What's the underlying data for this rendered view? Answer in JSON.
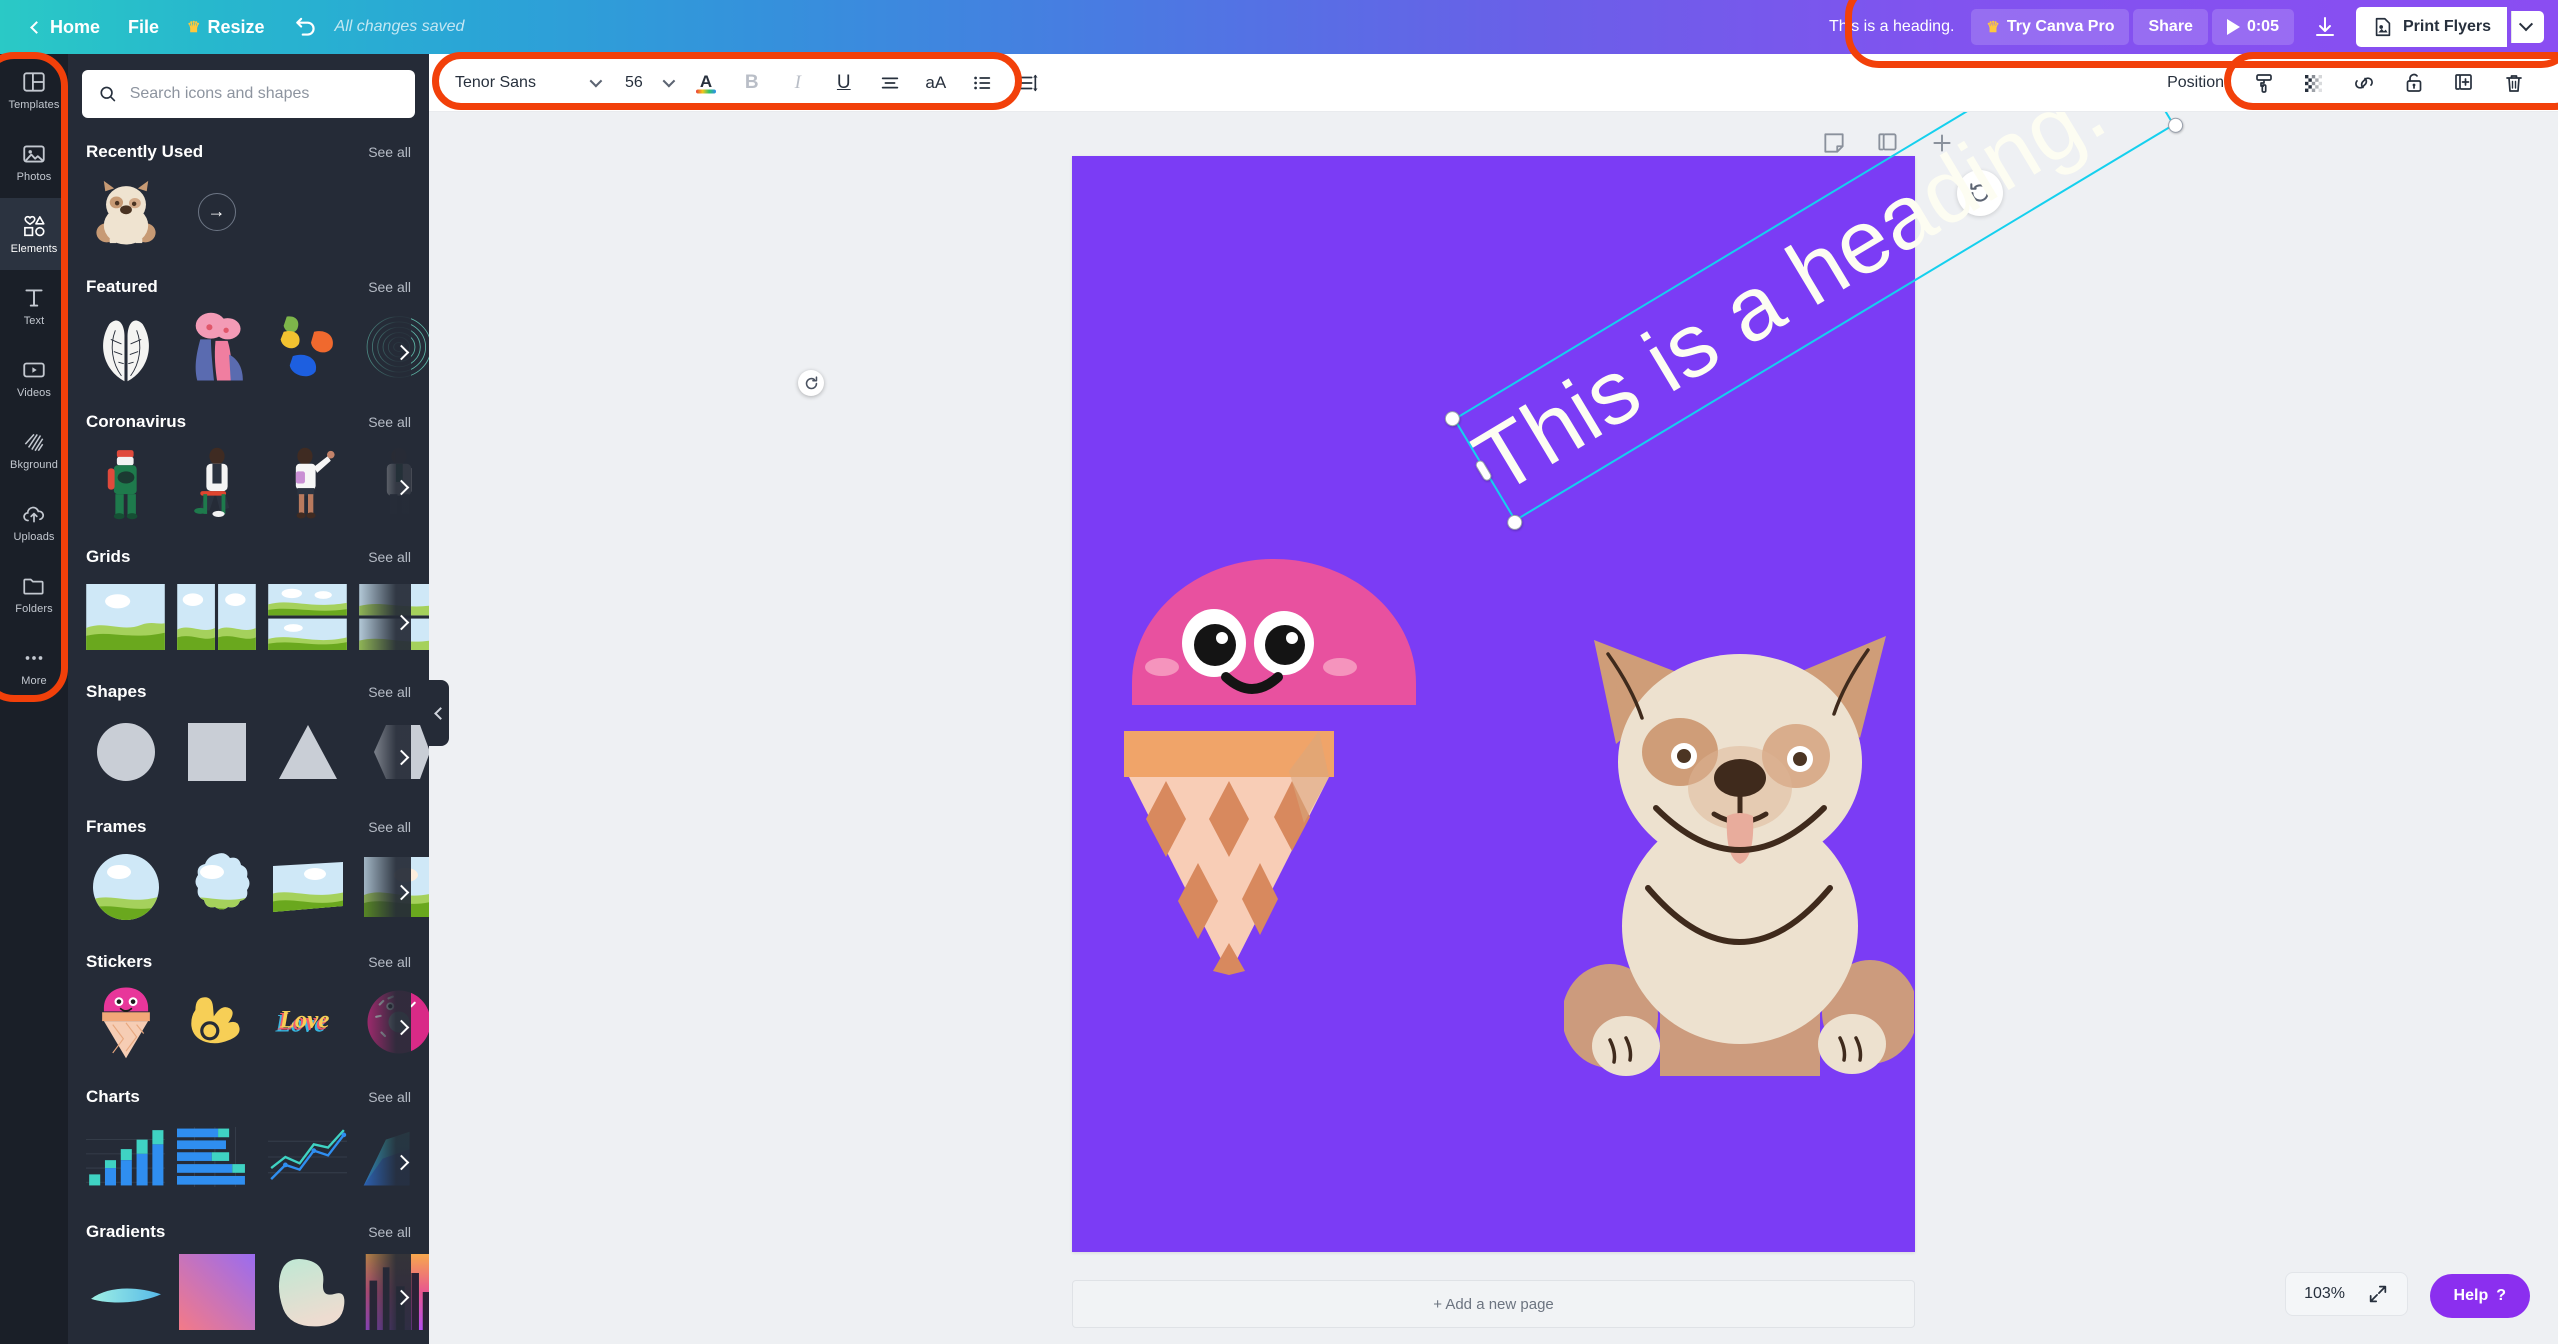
{
  "header": {
    "home_label": "Home",
    "file_label": "File",
    "resize_label": "Resize",
    "undo_icon": "undo-icon",
    "status": "All changes saved",
    "doc_title": "This is a heading.",
    "try_pro_label": "Try Canva Pro",
    "share_label": "Share",
    "timer_label": "0:05",
    "download_icon": "download-icon",
    "print_label": "Print Flyers",
    "accent_purple": "#8b2fef"
  },
  "toolbar": {
    "font_family": "Tenor Sans",
    "font_size": "56",
    "text_color_label": "A",
    "bold_label": "B",
    "italic_label": "I",
    "underline_label": "U",
    "align_icon": "align-center-icon",
    "case_label": "aA",
    "list_icon": "bullet-list-icon",
    "spacing_icon": "line-spacing-icon",
    "position_label": "Position",
    "copy_style_icon": "paint-roller-icon",
    "transparency_icon": "transparency-icon",
    "link_icon": "link-icon",
    "lock_icon": "lock-icon",
    "duplicate_icon": "duplicate-icon",
    "delete_icon": "trash-icon"
  },
  "search": {
    "placeholder": "Search icons and shapes",
    "icon": "search-icon"
  },
  "rail": {
    "items": [
      {
        "label": "Templates",
        "icon": "templates-icon",
        "active": false
      },
      {
        "label": "Photos",
        "icon": "photos-icon",
        "active": false
      },
      {
        "label": "Elements",
        "icon": "elements-icon",
        "active": true
      },
      {
        "label": "Text",
        "icon": "text-icon",
        "active": false
      },
      {
        "label": "Videos",
        "icon": "videos-icon",
        "active": false
      },
      {
        "label": "Bkground",
        "icon": "background-icon",
        "active": false
      },
      {
        "label": "Uploads",
        "icon": "uploads-icon",
        "active": false
      },
      {
        "label": "Folders",
        "icon": "folders-icon",
        "active": false
      },
      {
        "label": "More",
        "icon": "more-icon",
        "active": false
      }
    ]
  },
  "panel": {
    "see_all": "See all",
    "sections": [
      {
        "title": "Recently Used"
      },
      {
        "title": "Featured"
      },
      {
        "title": "Coronavirus"
      },
      {
        "title": "Grids"
      },
      {
        "title": "Shapes"
      },
      {
        "title": "Frames"
      },
      {
        "title": "Stickers"
      },
      {
        "title": "Charts"
      },
      {
        "title": "Gradients"
      }
    ]
  },
  "canvas": {
    "background_color": "#7b3cf5",
    "heading_text": "This is a heading.",
    "heading_color": "#fdfdf2",
    "rotation_degrees": "-31",
    "notes_icon": "notes-icon",
    "duplicate_page_icon": "duplicate-page-icon",
    "add_page_icon": "plus-icon",
    "animate_icon": "animate-icon",
    "add_page_label": "+ Add a new page"
  },
  "footer": {
    "zoom_level": "103%",
    "expand_icon": "expand-icon",
    "help_label": "Help",
    "help_mark": "?"
  }
}
